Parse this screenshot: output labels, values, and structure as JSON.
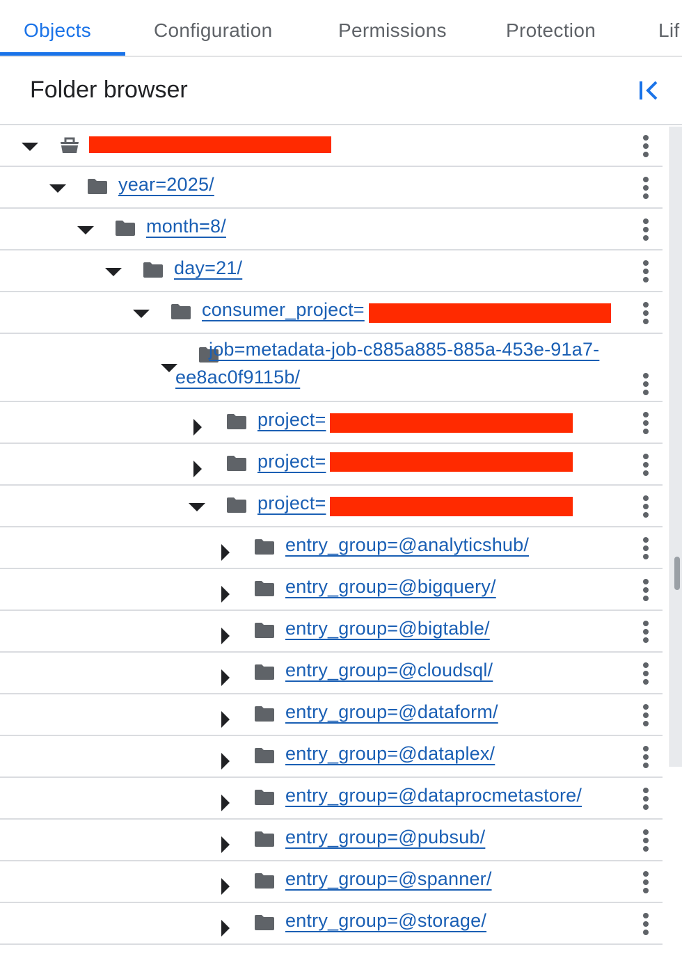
{
  "tabs": [
    {
      "label": "Objects"
    },
    {
      "label": "Configuration"
    },
    {
      "label": "Permissions"
    },
    {
      "label": "Protection"
    },
    {
      "label": "Lif"
    }
  ],
  "active_tab": "Objects",
  "header": {
    "title": "Folder browser",
    "collapse_icon": "collapse-left-icon"
  },
  "colors": {
    "accent": "#1a73e8",
    "link": "#1a5fb4",
    "redaction": "#ff2a00",
    "icon": "#5f6368"
  },
  "tree": [
    {
      "label": "",
      "expanded": true,
      "icon": "bucket-icon",
      "redacted": true
    },
    {
      "label": "year=2025/",
      "expanded": true,
      "icon": "folder-icon"
    },
    {
      "label": "month=8/",
      "expanded": true,
      "icon": "folder-icon"
    },
    {
      "label": "day=21/",
      "expanded": true,
      "icon": "folder-icon"
    },
    {
      "label": "consumer_project=",
      "expanded": true,
      "icon": "folder-icon",
      "redacted": true
    },
    {
      "label": "job=metadata-job-c885a885-885a-453e-91a7-ee8ac0f9115b/",
      "expanded": true,
      "icon": "folder-icon"
    },
    {
      "label": "project=",
      "expanded": false,
      "icon": "folder-icon",
      "redacted": true
    },
    {
      "label": "project=",
      "expanded": false,
      "icon": "folder-icon",
      "redacted": true
    },
    {
      "label": "project=",
      "expanded": true,
      "icon": "folder-icon",
      "redacted": true
    },
    {
      "label": "entry_group=@analyticshub/",
      "expanded": false,
      "icon": "folder-icon"
    },
    {
      "label": "entry_group=@bigquery/",
      "expanded": false,
      "icon": "folder-icon"
    },
    {
      "label": "entry_group=@bigtable/",
      "expanded": false,
      "icon": "folder-icon"
    },
    {
      "label": "entry_group=@cloudsql/",
      "expanded": false,
      "icon": "folder-icon"
    },
    {
      "label": "entry_group=@dataform/",
      "expanded": false,
      "icon": "folder-icon"
    },
    {
      "label": "entry_group=@dataplex/",
      "expanded": false,
      "icon": "folder-icon"
    },
    {
      "label": "entry_group=@dataprocmetastore/",
      "expanded": false,
      "icon": "folder-icon"
    },
    {
      "label": "entry_group=@pubsub/",
      "expanded": false,
      "icon": "folder-icon"
    },
    {
      "label": "entry_group=@spanner/",
      "expanded": false,
      "icon": "folder-icon"
    },
    {
      "label": "entry_group=@storage/",
      "expanded": false,
      "icon": "folder-icon"
    }
  ]
}
